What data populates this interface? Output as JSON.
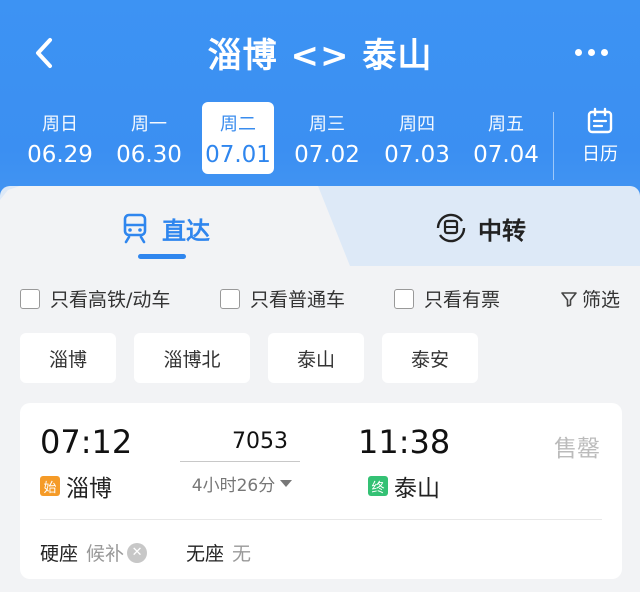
{
  "header": {
    "title": "淄博 <> 泰山"
  },
  "dates": [
    {
      "weekday": "周日",
      "date": "06.29",
      "active": false
    },
    {
      "weekday": "周一",
      "date": "06.30",
      "active": false
    },
    {
      "weekday": "周二",
      "date": "07.01",
      "active": true
    },
    {
      "weekday": "周三",
      "date": "07.02",
      "active": false
    },
    {
      "weekday": "周四",
      "date": "07.03",
      "active": false
    },
    {
      "weekday": "周五",
      "date": "07.04",
      "active": false
    }
  ],
  "calendar_label": "日历",
  "tabs": {
    "direct": "直达",
    "transfer": "中转"
  },
  "filters": {
    "high_speed": "只看高铁/动车",
    "regular": "只看普通车",
    "available": "只看有票",
    "filter_button": "筛选"
  },
  "stations": [
    "淄博",
    "淄博北",
    "泰山",
    "泰安"
  ],
  "train": {
    "dep_time": "07:12",
    "train_no": "7053",
    "arr_time": "11:38",
    "duration": "4小时26分",
    "status": "售罄",
    "dep_station": "淄博",
    "dep_badge": "始",
    "arr_station": "泰山",
    "arr_badge": "终",
    "seats": [
      {
        "name": "硬座",
        "status": "候补"
      },
      {
        "name": "无座",
        "status": "无"
      }
    ]
  },
  "colors": {
    "header_blue": "#3b8ff2",
    "accent_blue": "#2f86ee",
    "start_badge": "#f59b28",
    "end_badge": "#34c174"
  }
}
